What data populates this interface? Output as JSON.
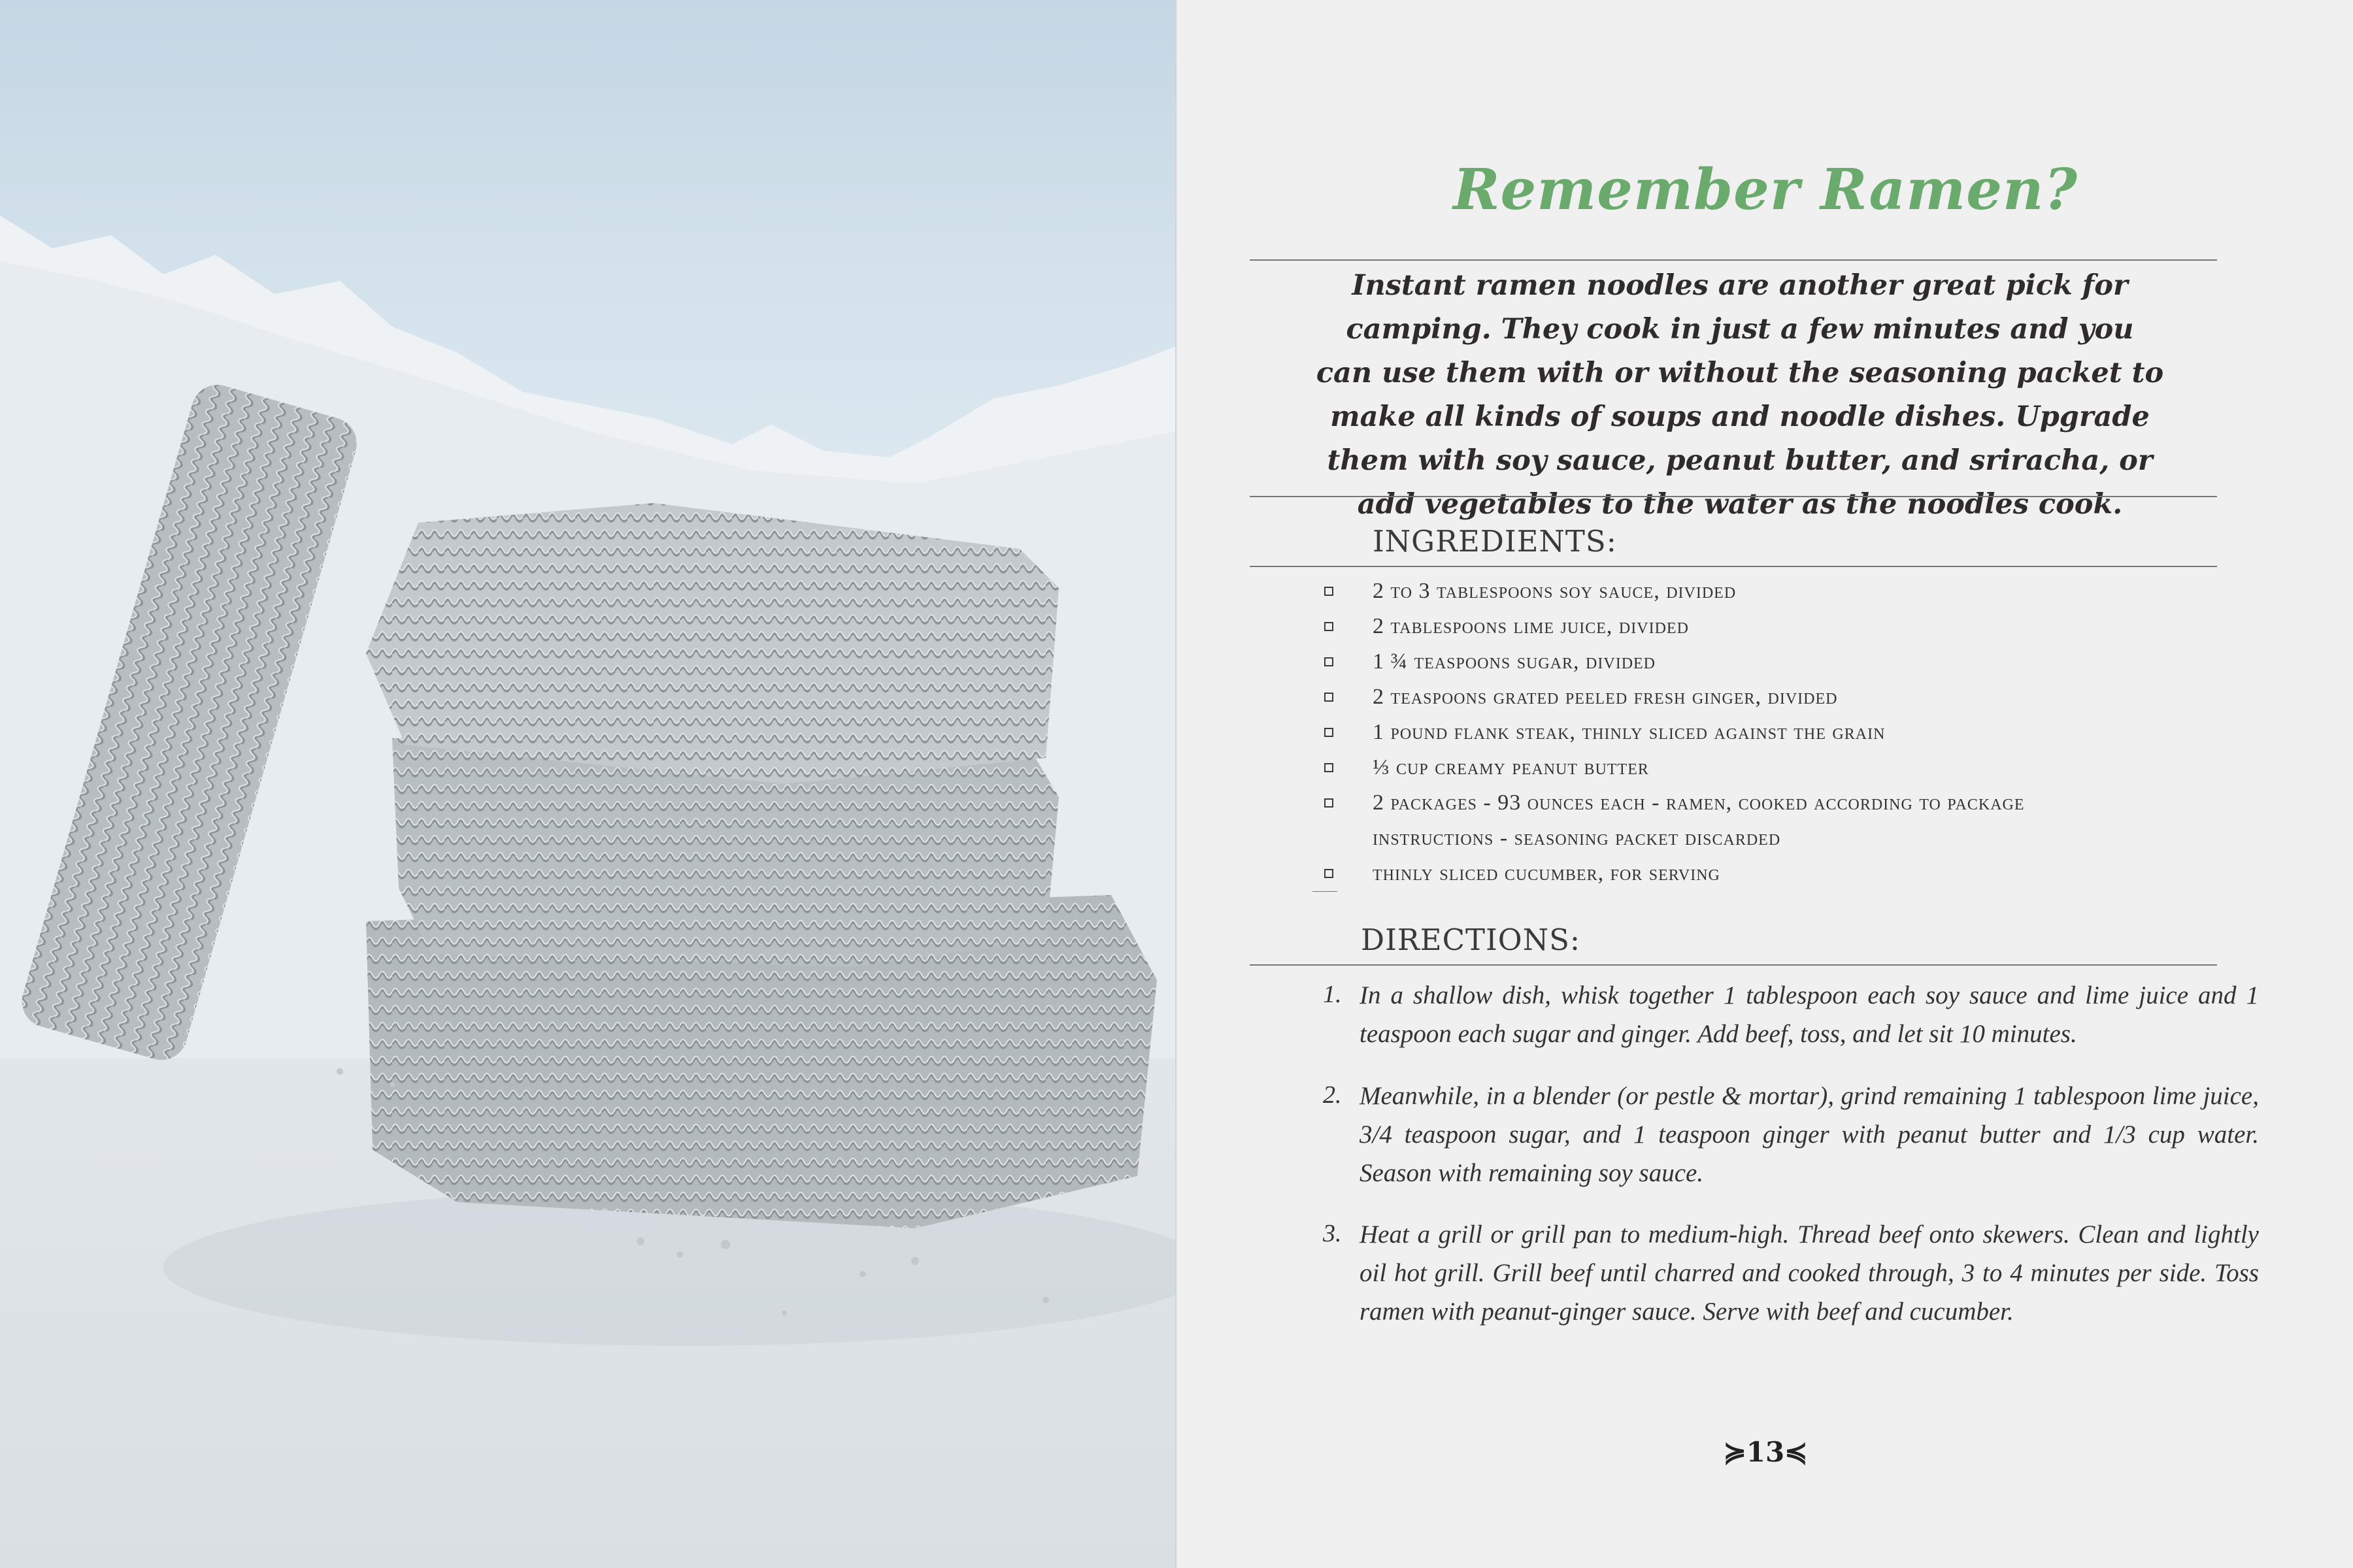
{
  "recipe": {
    "title": "Remember Ramen?",
    "intro": "Instant ramen noodles are another great pick for camping. They cook in just a few minutes and you can use them with or without the seasoning packet to make all kinds of soups and noodle dishes. Upgrade them with soy sauce, peanut butter, and sriracha, or add vegetables to the water as the noodles cook.",
    "ingredients_heading": "INGREDIENTS:",
    "ingredients": [
      "2 to 3 tablespoons soy sauce, divided",
      "2 tablespoons lime juice, divided",
      "1 ¾ teaspoons sugar, divided",
      "2 teaspoons grated peeled fresh ginger, divided",
      "1 pound flank steak, thinly sliced against the grain",
      "⅓ cup creamy peanut butter",
      "2 packages - 93 ounces each - ramen, cooked according to package",
      "thinly sliced cucumber, for serving"
    ],
    "ingredient_continuation": "instructions - seasoning packet discarded",
    "directions_heading": "DIRECTIONS:",
    "directions": [
      {
        "num": "1.",
        "text": "In a shallow dish, whisk together 1 tablespoon each soy sauce and lime juice and 1 teaspoon each sugar and ginger. Add beef, toss, and let sit 10 minutes."
      },
      {
        "num": "2.",
        "text": "Meanwhile, in a blender (or pestle & mortar), grind remaining 1 tablespoon lime juice, 3/4 teaspoon sugar, and 1 teaspoon ginger with peanut butter and 1/3 cup water. Season with remaining soy sauce."
      },
      {
        "num": "3.",
        "text": "Heat a grill or grill pan to medium-high. Thread beef onto skewers. Clean and lightly oil hot grill. Grill beef until charred and cooked through, 3 to 4 minutes per side. Toss ramen with peanut-ginger sauce. Serve with beef and cucumber."
      }
    ],
    "page_number": "13"
  },
  "colors": {
    "title": "#6aaa6c",
    "page_bg": "#f0f0f0",
    "text": "#333333"
  }
}
